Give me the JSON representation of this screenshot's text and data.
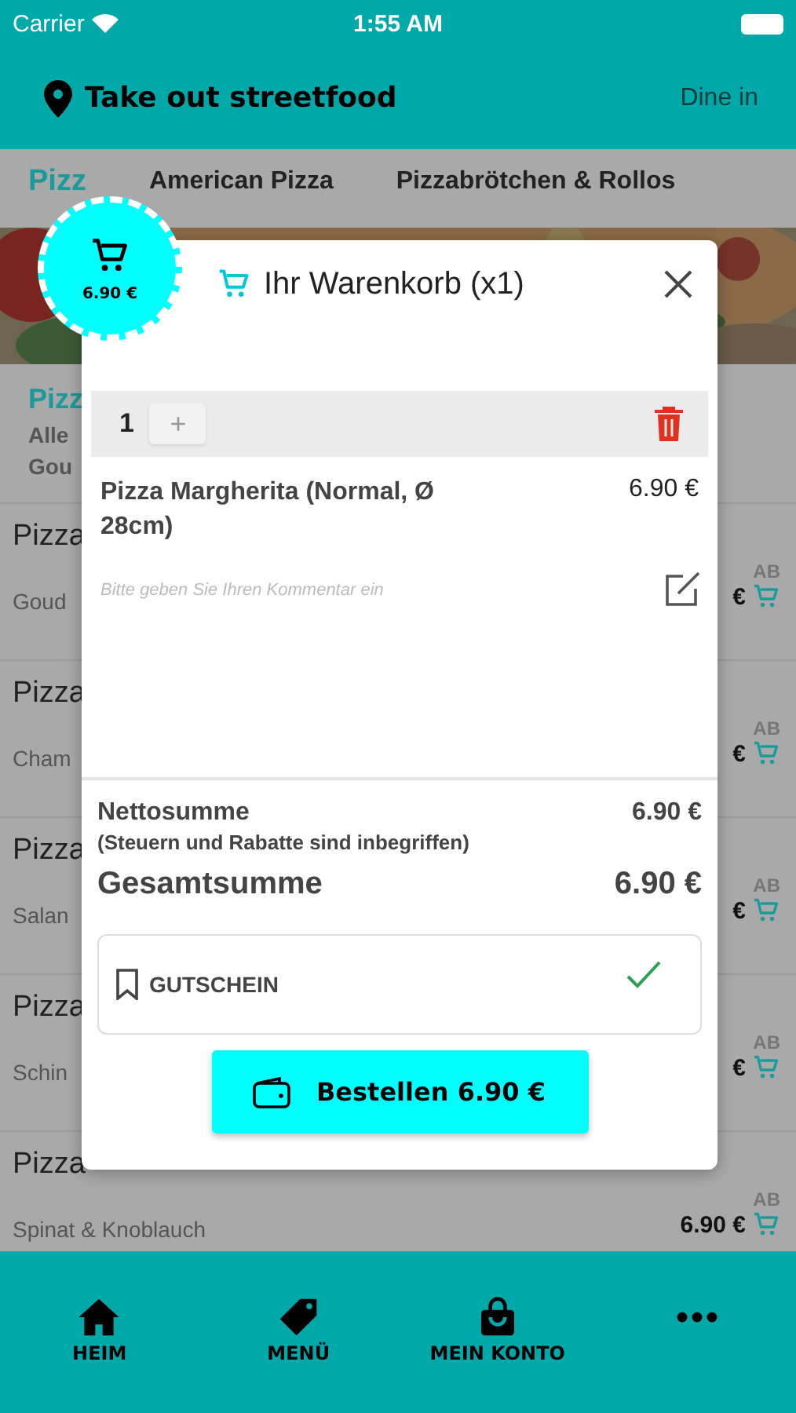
{
  "status_bar": {
    "carrier": "Carrier",
    "time": "1:55 AM"
  },
  "header": {
    "location": "Take out streetfood",
    "dine_in": "Dine in"
  },
  "tabs": [
    {
      "label": "Pizz",
      "selected": true
    },
    {
      "label": "American Pizza",
      "selected": false
    },
    {
      "label": "Pizzabrötchen & Rollos",
      "selected": false
    }
  ],
  "category": {
    "title": "Pizz",
    "lines": [
      "Alle",
      "Gou"
    ]
  },
  "products": [
    {
      "title": "Pizza",
      "description": "Goud",
      "from": "AB",
      "price": "€"
    },
    {
      "title": "Pizza",
      "description": "Cham",
      "from": "AB",
      "price": "€"
    },
    {
      "title": "Pizza",
      "description": "Salan",
      "from": "AB",
      "price": "€"
    },
    {
      "title": "Pizza",
      "description": "Schin",
      "from": "AB",
      "price": "€"
    },
    {
      "title": "Pizza",
      "description": "Spinat & Knoblauch",
      "from": "AB",
      "price": "6.90 €"
    }
  ],
  "cart_badge": {
    "total": "6.90 €"
  },
  "cart": {
    "title": "Ihr Warenkorb (x1)",
    "items": [
      {
        "quantity": "1",
        "plus": "+",
        "name": "Pizza Margherita (Normal, Ø 28cm)",
        "price": "6.90 €",
        "comment_placeholder": "Bitte geben Sie Ihren Kommentar ein"
      }
    ],
    "net_label": "Nettosumme",
    "net_note": "(Steuern und Rabatte sind inbegriffen)",
    "net_value": "6.90 €",
    "total_label": "Gesamtsumme",
    "total_value": "6.90 €",
    "voucher": {
      "label": "GUTSCHEIN",
      "applied": true
    },
    "order_button": "Bestellen 6.90 €"
  },
  "nav": [
    {
      "kind": "home",
      "label": "HEIM"
    },
    {
      "kind": "tag",
      "label": "MENÜ"
    },
    {
      "kind": "bag",
      "label": "MEIN KONTO"
    },
    {
      "kind": "more"
    }
  ]
}
